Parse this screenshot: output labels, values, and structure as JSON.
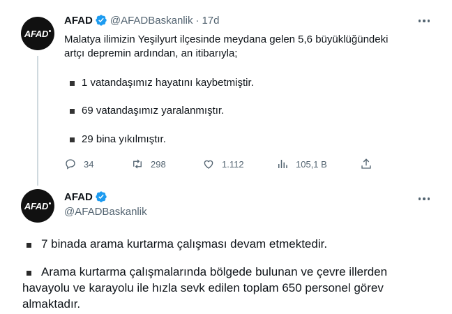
{
  "tweet1": {
    "avatar_text": "AFAD",
    "name": "AFAD",
    "handle": "@AFADBaskanlik",
    "separator": "·",
    "time": "17d",
    "text_line1": "Malatya ilimizin Yeşilyurt ilçesinde meydana gelen 5,6 büyüklüğündeki",
    "text_line2": "artçı depremin ardından, an itibarıyla;",
    "bullets": [
      "1 vatandaşımız hayatını kaybetmiştir.",
      "69 vatandaşımız yaralanmıştır.",
      "29 bina yıkılmıştır."
    ],
    "actions": {
      "replies": "34",
      "retweets": "298",
      "likes": "1.112",
      "views": "105,1 B"
    }
  },
  "tweet2": {
    "avatar_text": "AFAD",
    "name": "AFAD",
    "handle": "@AFADBaskanlik",
    "bullet1": "7 binada arama kurtarma çalışması devam etmektedir.",
    "bullet2_line1": "Arama kurtarma çalışmalarında bölgede bulunan ve çevre illerden",
    "bullet2_line2": "havayolu ve karayolu ile hızla sevk edilen toplam 650 personel görev",
    "bullet2_line3": "almaktadır."
  },
  "colors": {
    "verified": "#1d9bf0",
    "secondary_text": "#536471",
    "thread_line": "#cfd9de"
  }
}
